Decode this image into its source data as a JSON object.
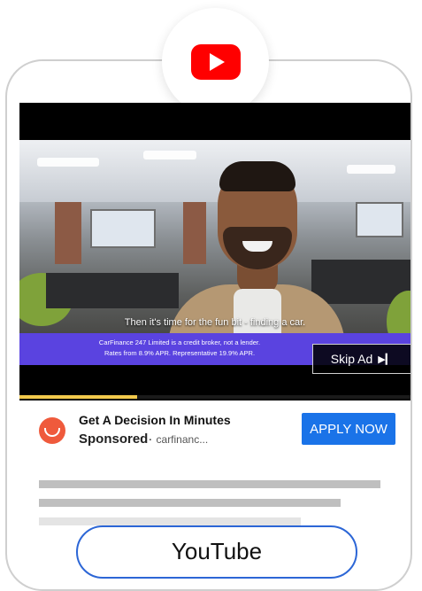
{
  "video": {
    "subtitle": "Then it's time for the fun bit - finding a car.",
    "disclaimer_line1": "CarFinance 247 Limited is a credit broker, not a lender.",
    "disclaimer_line2": "Rates from 8.9% APR. Representative 19.9% APR.",
    "skip_label": "Skip Ad",
    "skip_icon": "skip-next-icon",
    "progress": 0.3
  },
  "ad": {
    "title": "Get A Decision In Minutes",
    "sponsored": "Sponsored",
    "separator": "·",
    "domain": "carfinanc...",
    "cta": "APPLY NOW",
    "logo_color": "#ef5a3c"
  },
  "bottom_button": {
    "label": "YouTube"
  },
  "colors": {
    "youtube_red": "#ff0000",
    "cta_blue": "#1a73e8",
    "banner_purple": "#5a43e0"
  }
}
